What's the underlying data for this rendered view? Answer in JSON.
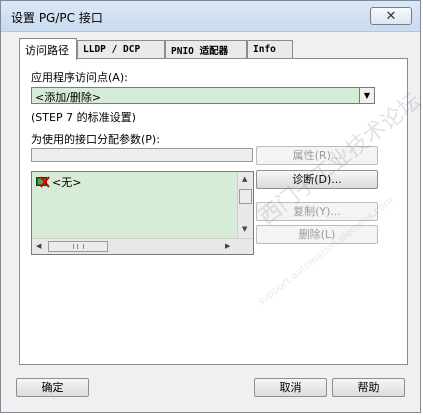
{
  "window": {
    "title": "设置 PG/PC 接口",
    "close_symbol": "✕"
  },
  "tabs": [
    {
      "label": "访问路径",
      "active": true
    },
    {
      "label": "LLDP / DCP",
      "active": false
    },
    {
      "label": "PNIO 适配器",
      "active": false
    },
    {
      "label": "Info",
      "active": false
    }
  ],
  "access_path": {
    "access_point_label": "应用程序访问点(A):",
    "access_point_value": "<添加/删除>",
    "access_point_note": "(STEP 7 的标准设置)",
    "param_label": "为使用的接口分配参数(P):",
    "param_value": "",
    "interfaces": [
      {
        "label": "<无>",
        "icon": "no-interface-icon"
      }
    ]
  },
  "side_buttons": {
    "properties": "属性(R)...",
    "diagnostics": "诊断(D)...",
    "copy": "复制(Y)...",
    "delete": "删除(L)"
  },
  "footer_buttons": {
    "ok": "确定",
    "cancel": "取消",
    "help": "帮助"
  },
  "watermark": {
    "main": "西门子工业技术论坛",
    "sub": "support.automation.siemens.com"
  },
  "colors": {
    "field_green": "#d6ecd6",
    "disabled_text": "#9b9b9b"
  }
}
